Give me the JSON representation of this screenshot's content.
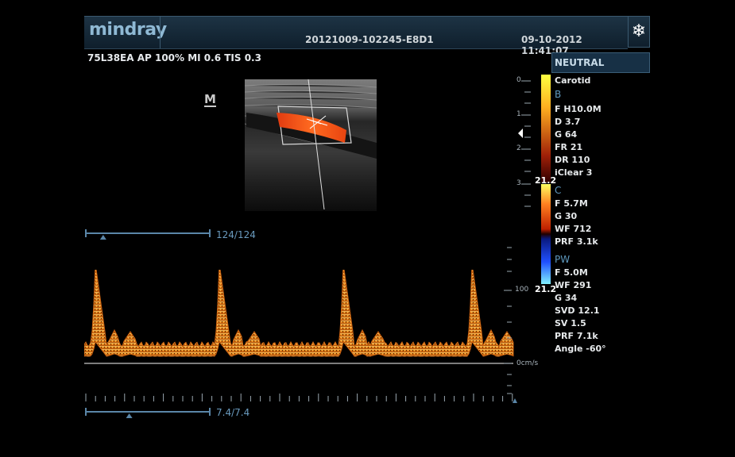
{
  "header": {
    "logo": "mindray",
    "study_id": "20121009-102245-E8D1",
    "datetime": "09-10-2012  11:41:07",
    "freeze_icon": "snowflake-icon"
  },
  "probe_info": "75L38EA  AP 100%  MI 0.6  TIS 0.3",
  "preset": "NEUTRAL",
  "image_marker": "M",
  "depth_ticks": [
    "0",
    "1",
    "2",
    "3"
  ],
  "b_params": {
    "exam": "Carotid",
    "mode": "B",
    "items": [
      "F H10.0M",
      "D 3.7",
      "G 64",
      "FR 21",
      "DR 110",
      "iClear 3"
    ]
  },
  "c_params": {
    "mode": "C",
    "items": [
      "F 5.7M",
      "G 30",
      "WF 712",
      "PRF 3.1k"
    ]
  },
  "pw_params": {
    "mode": "PW",
    "items": [
      "F 5.0M",
      "WF 291",
      "G 34",
      "SVD 12.1",
      "SV 1.5",
      "PRF 7.1k",
      "Angle -60°"
    ]
  },
  "colorbar_scale": "21.2",
  "colorbar_scale_bottom": "21.2",
  "spectral": {
    "velocity_label": "100",
    "baseline_label": "0cm/s"
  },
  "cine_slider_b": {
    "label": "124/124",
    "position": 0.14
  },
  "cine_slider_pw": {
    "label": "7.4/7.4",
    "position": 0.35
  },
  "colors": {
    "header_bg": "#1a2f40",
    "accent": "#5f9ac0",
    "doppler_orange": "#e07a10",
    "flow_red": "#ff4a10"
  }
}
